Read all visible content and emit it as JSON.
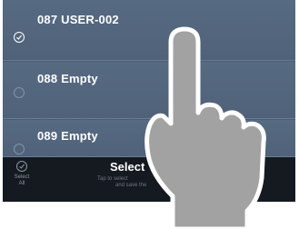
{
  "list": {
    "items": [
      {
        "label": "087 USER-002",
        "selected": true
      },
      {
        "label": "088 Empty",
        "selected": false
      },
      {
        "label": "089 Empty",
        "selected": false
      }
    ]
  },
  "toolbar": {
    "select_all_line1": "Select",
    "select_all_line2": "All",
    "title": "Select",
    "hint_line1": "Tap to select",
    "hint_line2": "and save the"
  },
  "icons": {
    "selected_check": "checkmark-circle-icon",
    "unselected": "empty-circle-icon",
    "select_all": "checkmark-circle-icon",
    "overlay": "pointing-hand-icon"
  },
  "colors": {
    "row_background": "#566a82",
    "toolbar_background": "#151a20",
    "text_primary": "#ffffff",
    "hand_fill": "#a2a2a2"
  }
}
